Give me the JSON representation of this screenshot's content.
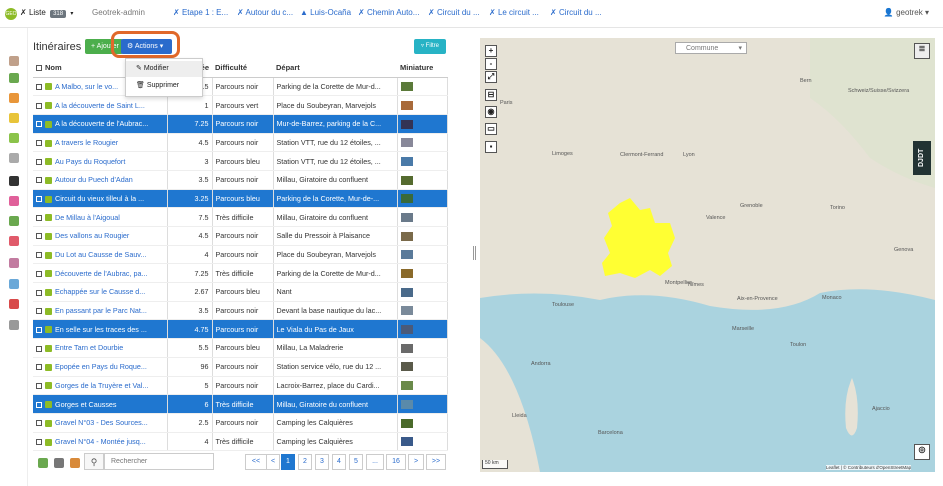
{
  "topnav": {
    "logo_text": "GEO",
    "liste_label": "Liste",
    "liste_count": "318",
    "caret": "▾",
    "context": "Geotrek-admin",
    "links": [
      "Etape 1 : E...",
      "Autour du c...",
      "Luis-Ocaña",
      "Chemin Auto...",
      "Circuit du ...",
      "Le circuit ...",
      "Circuit du ..."
    ],
    "user": "geotrek"
  },
  "list": {
    "title": "Itinéraires",
    "add_label": "+ Ajouter",
    "actions_label": "Actions",
    "filter_label": "Filtre",
    "actions_menu": [
      {
        "icon": "edit-icon",
        "label": "Modifier"
      },
      {
        "icon": "trash-icon",
        "label": "Supprimer"
      }
    ],
    "columns": [
      "Nom",
      "Durée",
      "Difficulté",
      "Départ",
      "Miniature"
    ],
    "rows": [
      {
        "name": "A Malbo, sur le vo...",
        "duration": "4.5",
        "difficulty": "Parcours noir",
        "start": "Parking de la Corette de Mur-d...",
        "selected": false
      },
      {
        "name": "A la découverte de Saint L...",
        "duration": "1",
        "difficulty": "Parcours vert",
        "start": "Place du Soubeyran, Marvejols",
        "selected": false
      },
      {
        "name": "A la découverte de l'Aubrac...",
        "duration": "7.25",
        "difficulty": "Parcours noir",
        "start": "Mur-de-Barrez, parking de la C...",
        "selected": true
      },
      {
        "name": "A travers le Rougier",
        "duration": "4.5",
        "difficulty": "Parcours noir",
        "start": "Station VTT, rue du 12 étoiles, ...",
        "selected": false
      },
      {
        "name": "Au Pays du Roquefort",
        "duration": "3",
        "difficulty": "Parcours bleu",
        "start": "Station VTT, rue du 12 étoiles, ...",
        "selected": false
      },
      {
        "name": "Autour du Puech d'Adan",
        "duration": "3.5",
        "difficulty": "Parcours noir",
        "start": "Millau, Giratoire du confluent",
        "selected": false
      },
      {
        "name": "Circuit du vieux tilleul à la ...",
        "duration": "3.25",
        "difficulty": "Parcours bleu",
        "start": "Parking de la Corette, Mur-de-...",
        "selected": true
      },
      {
        "name": "De Millau à l'Aigoual",
        "duration": "7.5",
        "difficulty": "Très difficile",
        "start": "Millau, Giratoire du confluent",
        "selected": false
      },
      {
        "name": "Des vallons au Rougier",
        "duration": "4.5",
        "difficulty": "Parcours noir",
        "start": "Salle du Pressoir à Plaisance",
        "selected": false
      },
      {
        "name": "Du Lot au Causse de Sauv...",
        "duration": "4",
        "difficulty": "Parcours noir",
        "start": "Place du Soubeyran, Marvejols",
        "selected": false
      },
      {
        "name": "Découverte de l'Aubrac, pa...",
        "duration": "7.25",
        "difficulty": "Très difficile",
        "start": "Parking de la Corette de Mur-d...",
        "selected": false
      },
      {
        "name": "Echappée sur le Causse d...",
        "duration": "2.67",
        "difficulty": "Parcours bleu",
        "start": "Nant",
        "selected": false
      },
      {
        "name": "En passant par le Parc Nat...",
        "duration": "3.5",
        "difficulty": "Parcours noir",
        "start": "Devant la base nautique du lac...",
        "selected": false
      },
      {
        "name": "En selle sur les traces des ...",
        "duration": "4.75",
        "difficulty": "Parcours noir",
        "start": "Le Viala du Pas de Jaux",
        "selected": true
      },
      {
        "name": "Entre Tarn et Dourbie",
        "duration": "5.5",
        "difficulty": "Parcours bleu",
        "start": "Millau, La Maladrerie",
        "selected": false
      },
      {
        "name": "Epopée en Pays du Roque...",
        "duration": "96",
        "difficulty": "Parcours noir",
        "start": "Station service vélo, rue du 12 ...",
        "selected": false
      },
      {
        "name": "Gorges de la Truyère et Val...",
        "duration": "5",
        "difficulty": "Parcours noir",
        "start": "Lacroix-Barrez, place du Cardi...",
        "selected": false
      },
      {
        "name": "Gorges et Causses",
        "duration": "6",
        "difficulty": "Très difficile",
        "start": "Millau, Giratoire du confluent",
        "selected": true
      },
      {
        "name": "Gravel N°03 - Des Sources...",
        "duration": "2.5",
        "difficulty": "Parcours noir",
        "start": "Camping les Calquières",
        "selected": false
      },
      {
        "name": "Gravel N°04 - Montée jusq...",
        "duration": "4",
        "difficulty": "Très difficile",
        "start": "Camping les Calquières",
        "selected": false
      }
    ],
    "search_placeholder": "Rechercher",
    "pagination": [
      "<<",
      "<",
      "1",
      "2",
      "3",
      "4",
      "5",
      "...",
      "16",
      ">",
      ">>"
    ],
    "current_page": "1"
  },
  "map": {
    "commune_select": "Commune",
    "scale": "50 km",
    "attribution": "Leaflet | © Contributeurs d'OpenStreetMap",
    "labels": [
      "Paris",
      "Bern",
      "Schweiz/Suisse/Svizzera",
      "Limoges",
      "Clermont-Ferrand",
      "Lyon",
      "Grenoble",
      "Torino",
      "Genova",
      "Valence",
      "Nîmes",
      "Montpellier",
      "Toulouse",
      "Aix-en-Provence",
      "Marseille",
      "Monaco",
      "Toulon",
      "Andorra",
      "Barcelona",
      "Lleida",
      "Ajaccio"
    ],
    "zoom_in": "+",
    "zoom_out": "-",
    "djdt": "DJDT"
  }
}
